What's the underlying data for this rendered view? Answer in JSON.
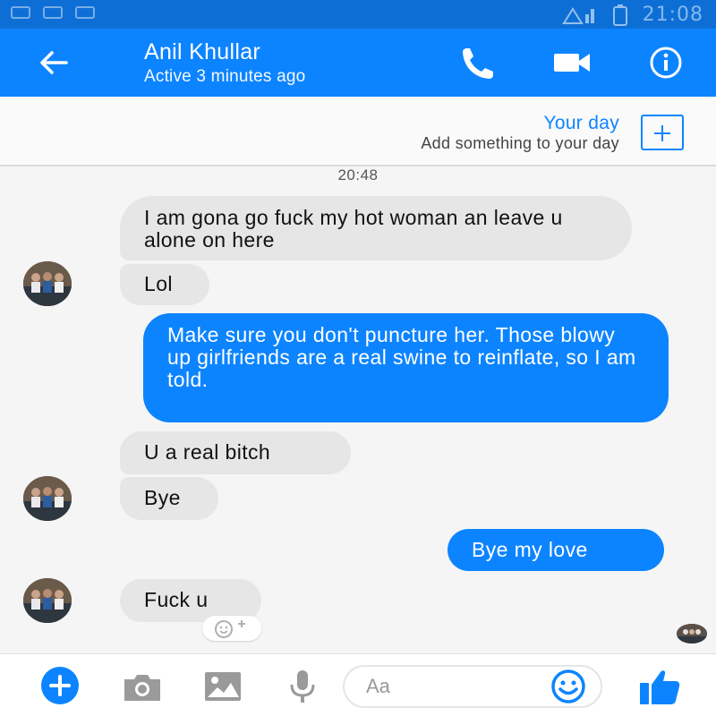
{
  "status_bar": {
    "time": "21:08"
  },
  "header": {
    "contact_name": "Anil Khullar",
    "contact_status": "Active 3 minutes ago",
    "icons": [
      "back-arrow-icon",
      "phone-icon",
      "video-camera-icon",
      "info-icon"
    ]
  },
  "your_day": {
    "title": "Your day",
    "subtitle": "Add something to your day"
  },
  "conversation": {
    "timestamp": "20:48",
    "messages": [
      {
        "from": "contact",
        "text": "I am gona go fuck my hot woman an leave u alone on here"
      },
      {
        "from": "contact",
        "text": "Lol"
      },
      {
        "from": "me",
        "text": "Make sure you don't puncture her. Those blowy up girlfriends are a real swine to reinflate, so I am told."
      },
      {
        "from": "contact",
        "text": "U a real bitch"
      },
      {
        "from": "contact",
        "text": "Bye"
      },
      {
        "from": "me",
        "text": "Bye my love"
      },
      {
        "from": "contact",
        "text": "Fuck u"
      }
    ]
  },
  "composer": {
    "placeholder": "Aa",
    "icons": [
      "plus-icon",
      "camera-icon",
      "image-icon",
      "microphone-icon",
      "smiley-icon",
      "thumbs-up-icon"
    ]
  },
  "colors": {
    "brand_blue": "#0d84ff",
    "status_bar_blue": "#0d6fd6",
    "received_bubble": "#e6e6e6",
    "background": "#f5f5f5"
  }
}
